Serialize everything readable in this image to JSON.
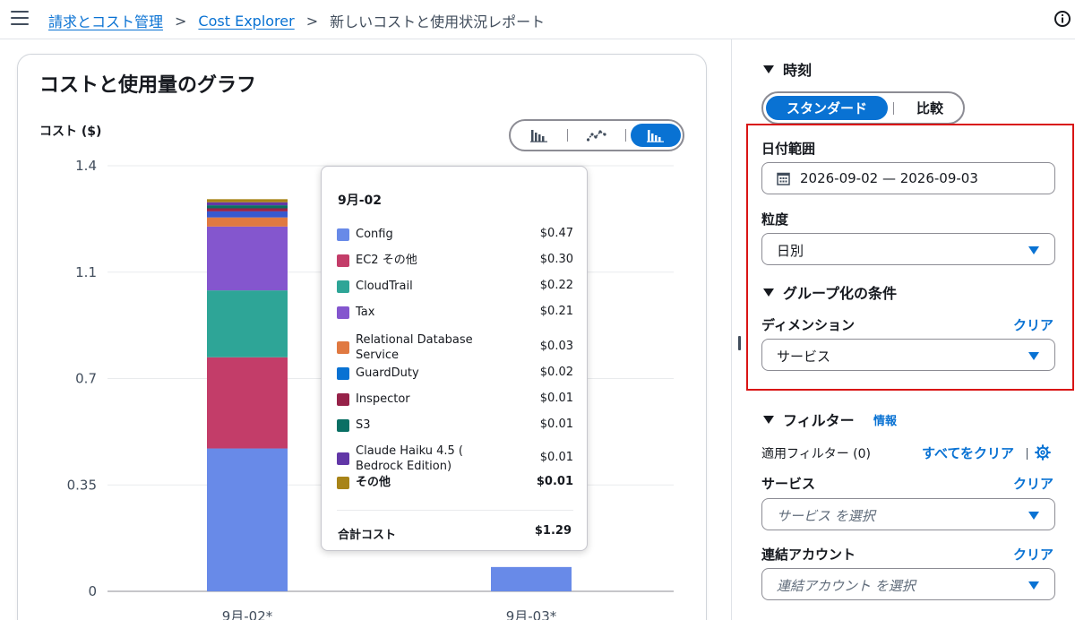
{
  "breadcrumb": {
    "items": [
      "請求とコスト管理",
      "Cost Explorer"
    ],
    "current": "新しいコストと使用状況レポート",
    "separator": ">"
  },
  "chart_card": {
    "title": "コストと使用量のグラフ",
    "chart_type_icons": [
      "bar-chart-icon",
      "line-chart-icon",
      "stacked-bar-chart-icon"
    ],
    "active_chart_type": "stacked-bar-chart-icon"
  },
  "chart_data": {
    "type": "bar",
    "stacked": true,
    "ylabel": "コスト ($)",
    "ylim": [
      0,
      1.4
    ],
    "yticks": [
      "1.4",
      "1.1",
      "0.7",
      "0.35",
      "0"
    ],
    "ytick_values": [
      1.4,
      1.05,
      0.7,
      0.35,
      0
    ],
    "grid": true,
    "categories": [
      "9月-02*",
      "9月-03*"
    ],
    "series": [
      {
        "name": "Config",
        "color": "#688ae8",
        "values": [
          0.47,
          0.08
        ]
      },
      {
        "name": "EC2 その他",
        "color": "#c33d69",
        "values": [
          0.3,
          0
        ]
      },
      {
        "name": "CloudTrail",
        "color": "#2ea597",
        "values": [
          0.22,
          0
        ]
      },
      {
        "name": "Tax",
        "color": "#8456ce",
        "values": [
          0.21,
          0
        ]
      },
      {
        "name": "Relational Database Service",
        "color": "#e07941",
        "values": [
          0.03,
          0
        ]
      },
      {
        "name": "GuardDuty",
        "color": "#3759ce",
        "values": [
          0.02,
          0
        ]
      },
      {
        "name": "Inspector",
        "color": "#962249",
        "values": [
          0.01,
          0
        ]
      },
      {
        "name": "S3",
        "color": "#096f64",
        "values": [
          0.01,
          0
        ]
      },
      {
        "name": "Claude Haiku 4.5 ( Bedrock Edition)",
        "color": "#6237a7",
        "values": [
          0.01,
          0
        ]
      },
      {
        "name": "その他",
        "color": "#a88418",
        "values": [
          0.01,
          0
        ]
      }
    ]
  },
  "tooltip": {
    "title": "9月-02",
    "rows": [
      {
        "name": "Config",
        "value": "$0.47",
        "color": "#688ae8"
      },
      {
        "name": "EC2 その他",
        "value": "$0.30",
        "color": "#c33d69"
      },
      {
        "name": "CloudTrail",
        "value": "$0.22",
        "color": "#2ea597"
      },
      {
        "name": "Tax",
        "value": "$0.21",
        "color": "#8456ce"
      },
      {
        "name": "Relational Database Service",
        "value": "$0.03",
        "color": "#e07941"
      },
      {
        "name": "GuardDuty",
        "value": "$0.02",
        "color": "#0972d3"
      },
      {
        "name": "Inspector",
        "value": "$0.01",
        "color": "#962249"
      },
      {
        "name": "S3",
        "value": "$0.01",
        "color": "#096f64"
      },
      {
        "name": "Claude Haiku 4.5 ( Bedrock Edition)",
        "value": "$0.01",
        "color": "#6237a7"
      },
      {
        "name": "その他",
        "value": "$0.01",
        "color": "#a88418"
      }
    ],
    "total_label": "合計コスト",
    "total_value": "$1.29"
  },
  "panel": {
    "time_section": "時刻",
    "mode_active": "スタンダード",
    "mode_inactive": "比較",
    "date_range_label": "日付範囲",
    "date_range_value": "2026-09-02 — 2026-09-03",
    "granularity_label": "粒度",
    "granularity_value": "日別",
    "group_section": "グループ化の条件",
    "dimension_label": "ディメンション",
    "dimension_clear": "クリア",
    "dimension_value": "サービス",
    "filter_section": "フィルター",
    "filter_info": "情報",
    "applied_filters": "適用フィルター (0)",
    "clear_all": "すべてをクリア",
    "service_label": "サービス",
    "service_clear": "クリア",
    "service_placeholder": "サービス を選択",
    "linked_account_label": "連結アカウント",
    "linked_account_clear": "クリア",
    "linked_account_placeholder": "連結アカウント を選択"
  },
  "colors": {
    "accent": "#0972d3",
    "highlight": "#d91515"
  }
}
